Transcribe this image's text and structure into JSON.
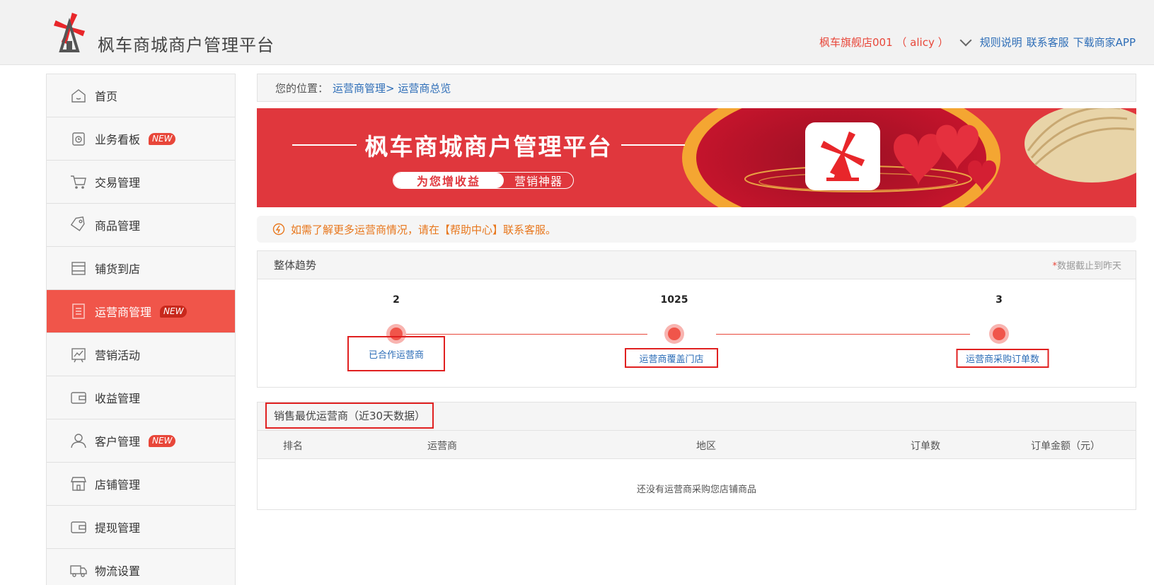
{
  "header": {
    "brand": "枫车商城商户管理平台",
    "store": "枫车旗舰店001 （ alicy ）",
    "links": [
      "规则说明",
      "联系客服",
      "下载商家APP"
    ]
  },
  "sidebar": {
    "items": [
      {
        "label": "首页",
        "icon": "home-icon",
        "new": ""
      },
      {
        "label": "业务看板",
        "icon": "dashboard-icon",
        "new": "NEW"
      },
      {
        "label": "交易管理",
        "icon": "cart-icon",
        "new": ""
      },
      {
        "label": "商品管理",
        "icon": "tag-icon",
        "new": ""
      },
      {
        "label": "铺货到店",
        "icon": "store-shelf-icon",
        "new": ""
      },
      {
        "label": "运营商管理",
        "icon": "document-icon",
        "new": "NEW"
      },
      {
        "label": "营销活动",
        "icon": "chart-board-icon",
        "new": ""
      },
      {
        "label": "收益管理",
        "icon": "wallet-icon",
        "new": ""
      },
      {
        "label": "客户管理",
        "icon": "user-icon",
        "new": "NEW"
      },
      {
        "label": "店铺管理",
        "icon": "shop-icon",
        "new": ""
      },
      {
        "label": "提现管理",
        "icon": "wallet-icon",
        "new": ""
      },
      {
        "label": "物流设置",
        "icon": "truck-icon",
        "new": ""
      }
    ],
    "active_index": 5
  },
  "breadcrumb": {
    "prefix": "您的位置：",
    "path": "运营商管理> 运营商总览"
  },
  "banner": {
    "title": "枫车商城商户管理平台",
    "pill_a": "为您增收益",
    "pill_b": "营销神器"
  },
  "notice": {
    "text": "如需了解更多运营商情况，请在【帮助中心】联系客服。"
  },
  "trend": {
    "title": "整体趋势",
    "note_star": "*",
    "note": "数据截止到昨天",
    "metrics": [
      {
        "value": "2",
        "label": "已合作运营商"
      },
      {
        "value": "1025",
        "label": "运营商覆盖门店"
      },
      {
        "value": "3",
        "label": "运营商采购订单数"
      }
    ]
  },
  "sales": {
    "title": "销售最优运营商（近30天数据）",
    "columns": [
      "排名",
      "运营商",
      "地区",
      "订单数",
      "订单金额（元）"
    ],
    "empty": "还没有运营商采购您店铺商品"
  },
  "colors": {
    "accent": "#f0554a",
    "link": "#2d6db7",
    "notice": "#e8771d"
  }
}
